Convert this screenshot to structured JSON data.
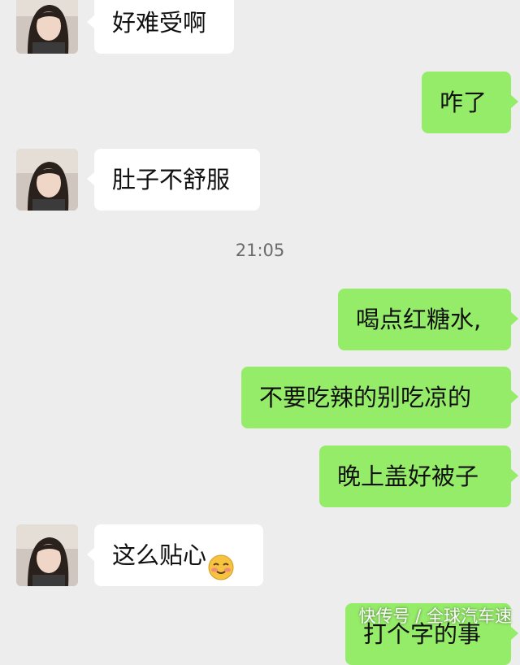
{
  "messages": [
    {
      "side": "in",
      "text": "好难受啊"
    },
    {
      "side": "out",
      "text": "咋了"
    },
    {
      "side": "in",
      "text": "肚子不舒服"
    },
    {
      "side": "out",
      "text": "喝点红糖水,"
    },
    {
      "side": "out",
      "text": "不要吃辣的别吃凉的"
    },
    {
      "side": "out",
      "text": "晚上盖好被子"
    },
    {
      "side": "in",
      "text": "这么贴心",
      "emoji": "blushing-smile-emoji"
    },
    {
      "side": "out",
      "text": "打个字的事"
    }
  ],
  "timestamp": "21:05",
  "watermark": "快传号 / 全球汽车速",
  "colors": {
    "background": "#ededed",
    "incoming_bubble": "#ffffff",
    "outgoing_bubble": "#95ec69"
  }
}
